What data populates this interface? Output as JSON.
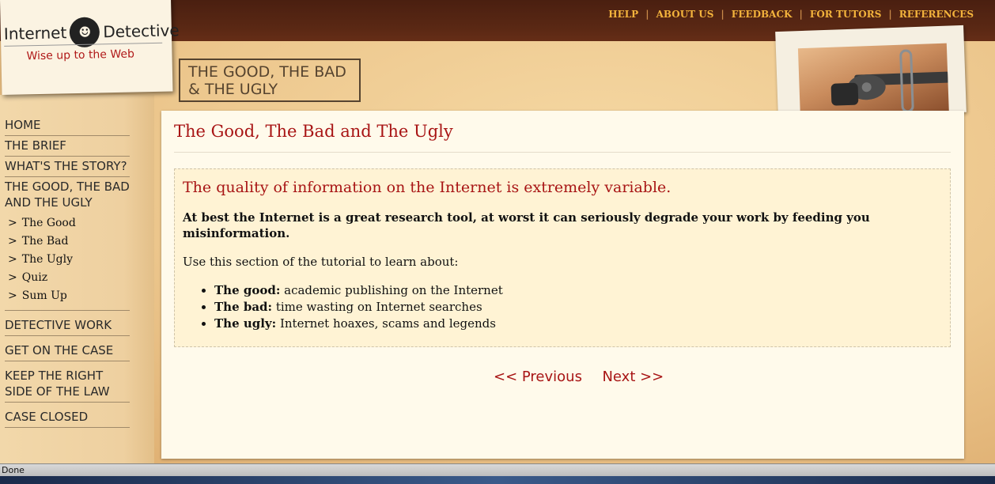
{
  "logo": {
    "word1": "Internet",
    "word2": "Detective",
    "tagline": "Wise up to the Web"
  },
  "topnav": [
    "HELP",
    "ABOUT US",
    "FEEDBACK",
    "FOR TUTORS",
    "REFERENCES"
  ],
  "section_stamp": "THE GOOD, THE BAD\n& THE UGLY",
  "sidebar": {
    "items": [
      {
        "label": "HOME"
      },
      {
        "label": "THE BRIEF"
      },
      {
        "label": "WHAT'S THE STORY?"
      },
      {
        "label": "THE GOOD, THE BAD\nAND THE UGLY"
      },
      {
        "label": "DETECTIVE WORK"
      },
      {
        "label": "GET ON THE CASE"
      },
      {
        "label": "KEEP THE RIGHT\nSIDE OF THE LAW"
      },
      {
        "label": "CASE CLOSED"
      }
    ],
    "subitems": [
      {
        "arrow": ">",
        "label": "The Good"
      },
      {
        "arrow": ">",
        "label": "The Bad"
      },
      {
        "arrow": ">",
        "label": "The Ugly"
      },
      {
        "arrow": ">",
        "label": "Quiz"
      },
      {
        "arrow": ">",
        "label": "Sum Up"
      }
    ]
  },
  "main": {
    "title": "The Good, The Bad and The Ugly",
    "lead": "The quality of information on the Internet is extremely variable.",
    "strong": "At best the Internet is a great research tool, at worst it can seriously degrade your work by feeding you misinformation.",
    "intro": "Use this section of the tutorial to learn about:",
    "list": [
      {
        "term": "The good:",
        "desc": " academic publishing on the Internet"
      },
      {
        "term": "The bad:",
        "desc": " time wasting on Internet searches"
      },
      {
        "term": "The ugly:",
        "desc": " Internet hoaxes, scams and legends"
      }
    ],
    "prev": "<< Previous",
    "next": "Next >>"
  },
  "status": "Done",
  "colors": {
    "accent_red": "#a81515",
    "nav_gold": "#f3b33c",
    "leather": "#4a1f10",
    "panel": "#fffaeb"
  },
  "icons": {
    "logo_badge": "detective-icon",
    "photo": "revolver-image"
  }
}
